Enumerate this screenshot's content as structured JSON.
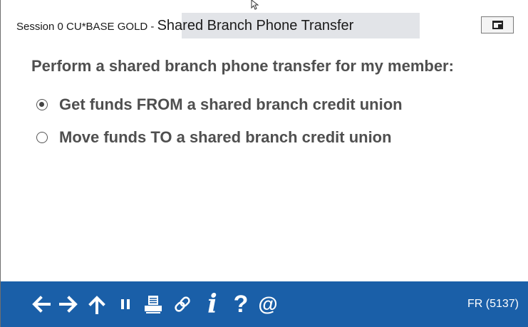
{
  "window": {
    "title_prefix": "Session 0 CU*BASE GOLD - ",
    "title_main": "Shared Branch Phone Transfer"
  },
  "content": {
    "prompt": "Perform a shared branch phone transfer for my member:",
    "options": [
      {
        "label": "Get funds FROM a shared branch credit union",
        "selected": true
      },
      {
        "label": "Move funds TO a shared branch credit union",
        "selected": false
      }
    ]
  },
  "toolbar": {
    "icons": [
      "back-arrow-icon",
      "forward-arrow-icon",
      "up-arrow-icon",
      "pause-icon",
      "printer-icon",
      "link-icon",
      "info-icon",
      "help-icon",
      "at-icon"
    ],
    "info_glyph": "i",
    "help_glyph": "?",
    "at_glyph": "@",
    "status_code": "FR (5137)",
    "background_color": "#1a5fa8"
  }
}
